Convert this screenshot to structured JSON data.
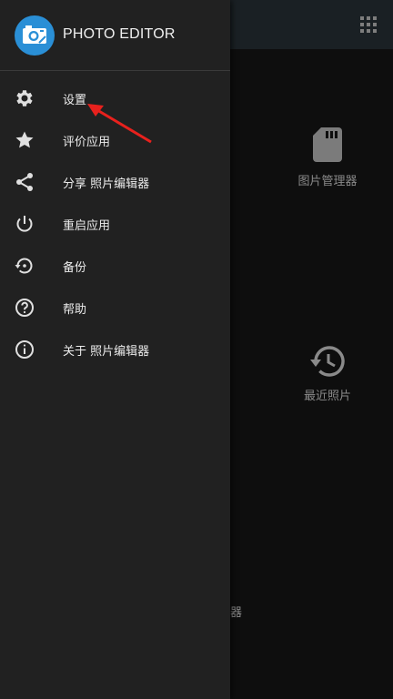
{
  "app": {
    "title": "PHOTO EDITOR"
  },
  "background": {
    "tiles": [
      {
        "icon": "sd-card-icon",
        "label": "图片管理器"
      },
      {
        "icon": "history-icon",
        "label": "最近照片"
      }
    ],
    "stray_text": "器"
  },
  "drawer": {
    "items": [
      {
        "icon": "gear-icon",
        "label": "设置"
      },
      {
        "icon": "star-icon",
        "label": "评价应用"
      },
      {
        "icon": "share-icon",
        "label": "分享 照片编辑器"
      },
      {
        "icon": "power-icon",
        "label": "重启应用"
      },
      {
        "icon": "backup-restore-icon",
        "label": "备份"
      },
      {
        "icon": "help-icon",
        "label": "帮助"
      },
      {
        "icon": "info-icon",
        "label": "关于 照片编辑器"
      }
    ]
  },
  "colors": {
    "drawer_bg": "#212121",
    "logo_bg": "#2a8fd6",
    "annotation_arrow": "#e8211d"
  }
}
